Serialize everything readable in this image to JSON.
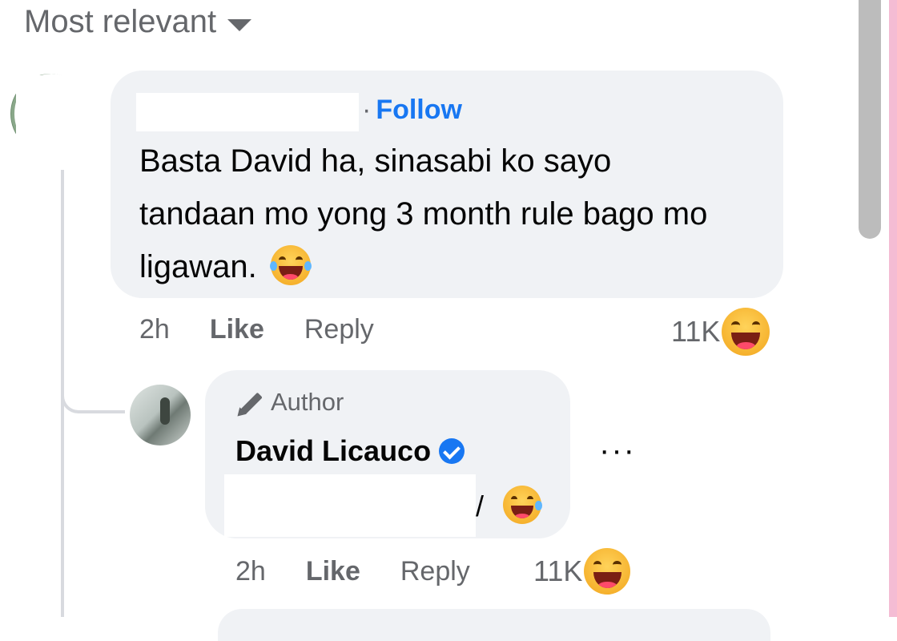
{
  "sort": {
    "label": "Most relevant"
  },
  "comment1": {
    "follow_label": "Follow",
    "separator": "·",
    "text": "Basta David ha, sinasabi ko sayo tandaan mo yong 3 month rule bago mo ligawan.",
    "time": "2h",
    "like_label": "Like",
    "reply_label": "Reply",
    "reaction_count": "11K"
  },
  "reply1": {
    "badge_label": "Author",
    "author_name": "David Licauco",
    "text_tail": "/",
    "more_label": "···",
    "time": "2h",
    "like_label": "Like",
    "reply_label": "Reply",
    "reaction_count": "11K"
  },
  "colors": {
    "link": "#1877f2",
    "bubble": "#f0f2f5",
    "muted": "#65676b",
    "verified": "#1877f2"
  }
}
